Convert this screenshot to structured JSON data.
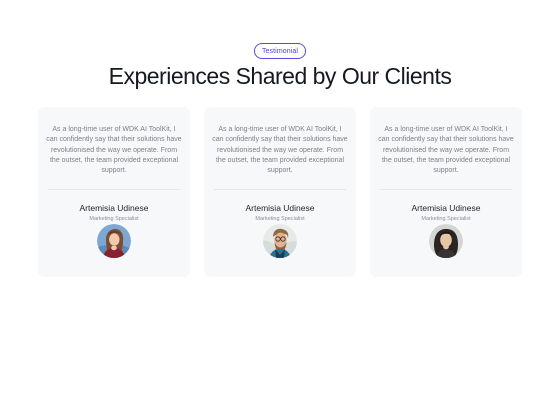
{
  "section": {
    "badge": "Testimonial",
    "title": "Experiences Shared by Our Clients"
  },
  "testimonials": [
    {
      "quote": "As a long-time user of WDK AI ToolKit, I can confidently say that their solutions have revolutionised the way we operate. From the outset, the team provided exceptional support.",
      "name": "Artemisia Udinese",
      "role": "Marketing Specialist",
      "avatar": "woman-long-hair-avatar"
    },
    {
      "quote": "As a long-time user of WDK AI ToolKit, I can confidently say that their solutions have revolutionised the way we operate. From the outset, the team provided exceptional support.",
      "name": "Artemisia Udinese",
      "role": "Marketing Specialist",
      "avatar": "man-beard-glasses-avatar"
    },
    {
      "quote": "As a long-time user of WDK AI ToolKit, I can confidently say that their solutions have revolutionised the way we operate. From the outset, the team provided exceptional support.",
      "name": "Artemisia Udinese",
      "role": "Marketing Specialist",
      "avatar": "woman-dark-hair-avatar"
    }
  ],
  "colors": {
    "accent": "#4b3fd6",
    "card_background": "#f7f8fa",
    "heading": "#151922",
    "body_text": "#7c808a"
  }
}
